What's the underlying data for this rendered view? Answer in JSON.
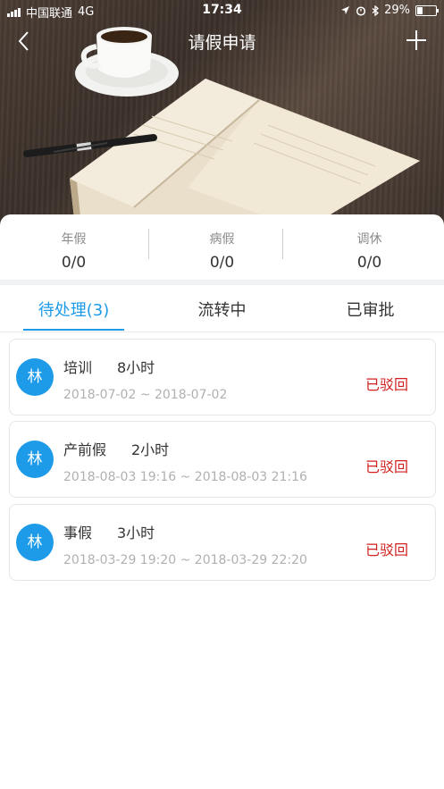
{
  "status_bar": {
    "carrier": "中国联通",
    "network": "4G",
    "time": "17:34",
    "battery": "29%"
  },
  "nav": {
    "title": "请假申请"
  },
  "stats": [
    {
      "label": "年假",
      "value": "0/0"
    },
    {
      "label": "病假",
      "value": "0/0"
    },
    {
      "label": "调休",
      "value": "0/0"
    }
  ],
  "tabs": [
    {
      "label": "待处理(3)",
      "active": true
    },
    {
      "label": "流转中",
      "active": false
    },
    {
      "label": "已审批",
      "active": false
    }
  ],
  "requests": [
    {
      "avatar": "林",
      "type": "培训",
      "hours": "8小时",
      "dates": "2018-07-02 ~ 2018-07-02",
      "status": "已驳回"
    },
    {
      "avatar": "林",
      "type": "产前假",
      "hours": "2小时",
      "dates": "2018-08-03 19:16 ~ 2018-08-03 21:16",
      "status": "已驳回"
    },
    {
      "avatar": "林",
      "type": "事假",
      "hours": "3小时",
      "dates": "2018-03-29 19:20 ~ 2018-03-29 22:20",
      "status": "已驳回"
    }
  ],
  "colors": {
    "accent": "#1e9be8",
    "status_rejected": "#d0211f"
  }
}
